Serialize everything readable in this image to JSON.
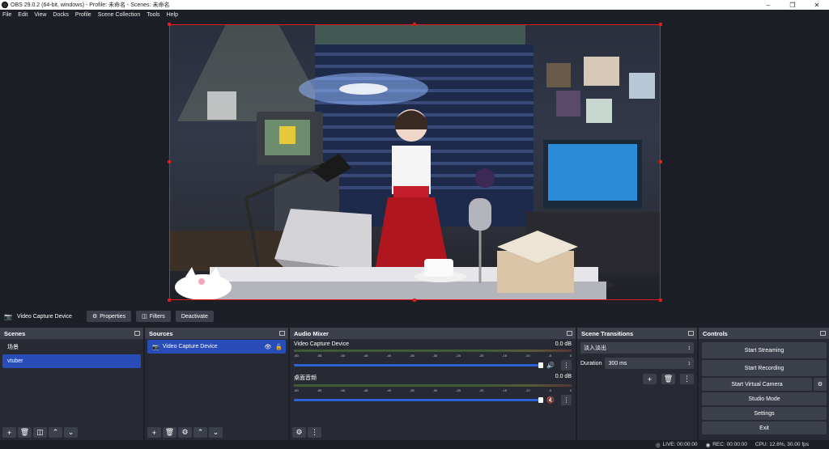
{
  "window": {
    "title": "OBS 29.0.2 (64-bit, windows) - Profile: 未命名 - Scenes: 未命名",
    "controls": [
      "minimize-icon",
      "maximize-icon",
      "close-icon"
    ]
  },
  "menu": [
    "File",
    "Edit",
    "View",
    "Docks",
    "Profile",
    "Scene Collection",
    "Tools",
    "Help"
  ],
  "propbar": {
    "source_name": "Video Capture Device",
    "properties": "Properties",
    "filters": "Filters",
    "deactivate": "Deactivate"
  },
  "scenes": {
    "title": "Scenes",
    "items": [
      "场景",
      "vtuber"
    ],
    "selected": 1
  },
  "sources": {
    "title": "Sources",
    "items": [
      "Video Capture Device"
    ]
  },
  "mixer": {
    "title": "Audio Mixer",
    "channels": [
      {
        "name": "Video Capture Device",
        "db": "0.0 dB",
        "muted": false
      },
      {
        "name": "桌面音频",
        "db": "0.0 dB",
        "muted": true
      }
    ],
    "ticks": [
      "-60",
      "-55",
      "-50",
      "-45",
      "-40",
      "-35",
      "-30",
      "-25",
      "-20",
      "-15",
      "-10",
      "-5",
      "0"
    ]
  },
  "transitions": {
    "title": "Scene Transitions",
    "selected": "淡入淡出",
    "duration_label": "Duration",
    "duration_value": "300 ms"
  },
  "controls": {
    "title": "Controls",
    "buttons": [
      "Start Streaming",
      "Start Recording",
      "Start Virtual Camera",
      "Studio Mode",
      "Settings",
      "Exit"
    ]
  },
  "status": {
    "live": "LIVE: 00:00:00",
    "rec": "REC: 00:00:00",
    "cpu": "CPU: 12.6%, 30.00 fps"
  },
  "colors": {
    "accent": "#284cb8",
    "selection": "#e01b1b",
    "background": "#1d1f26",
    "dock": "#272a33"
  }
}
